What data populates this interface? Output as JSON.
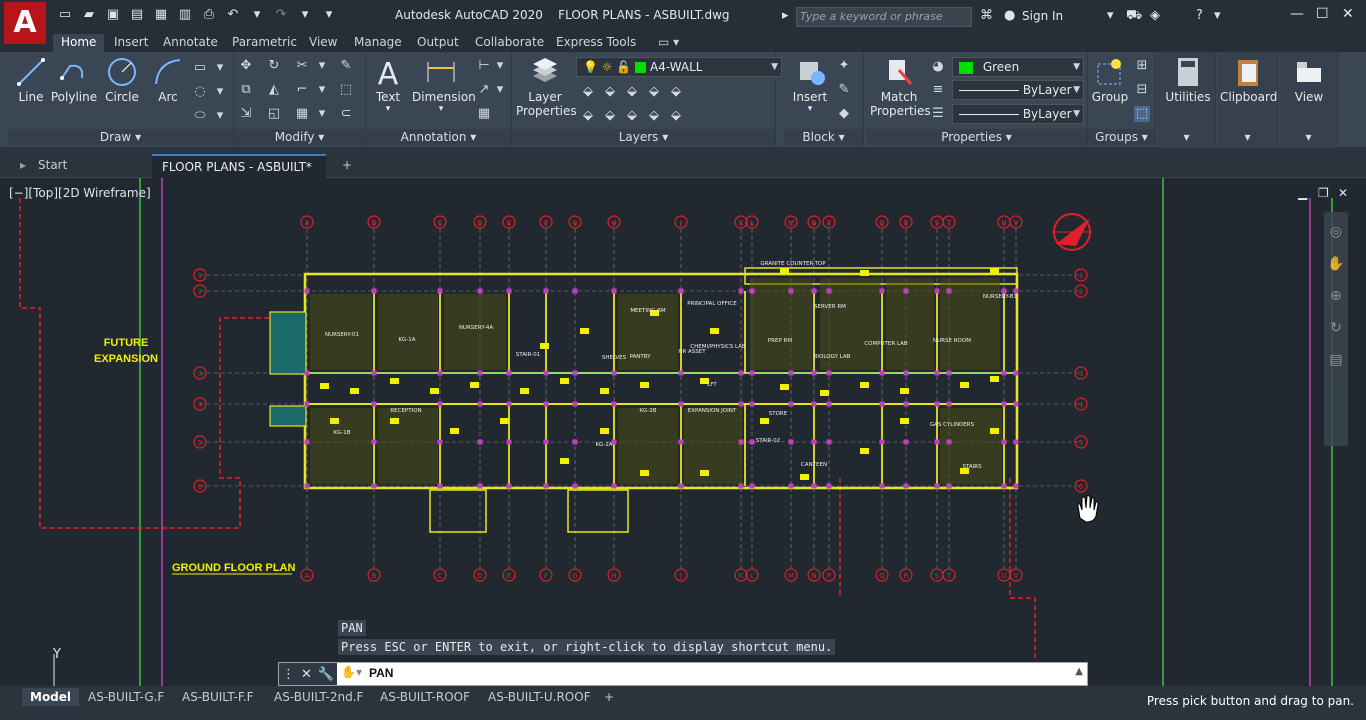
{
  "app": {
    "logo_letter": "A",
    "title": "Autodesk AutoCAD 2020    FLOOR PLANS - ASBUILT.dwg",
    "search_placeholder": "Type a keyword or phrase",
    "signin": "Sign In"
  },
  "ribbon_tabs": [
    "Home",
    "Insert",
    "Annotate",
    "Parametric",
    "View",
    "Manage",
    "Output",
    "Collaborate",
    "Express Tools"
  ],
  "ribbon": {
    "draw": {
      "title": "Draw",
      "line": "Line",
      "polyline": "Polyline",
      "circle": "Circle",
      "arc": "Arc"
    },
    "modify": {
      "title": "Modify"
    },
    "annotation": {
      "title": "Annotation",
      "text": "Text",
      "dimension": "Dimension"
    },
    "layers": {
      "title": "Layers",
      "layer_properties": "Layer\nProperties",
      "layer_properties_1": "Layer",
      "layer_properties_2": "Properties",
      "current_layer": "A4-WALL"
    },
    "block": {
      "title": "Block",
      "insert": "Insert"
    },
    "properties": {
      "title": "Properties",
      "match_1": "Match",
      "match_2": "Properties",
      "color": "Green",
      "linetype": "ByLayer",
      "lineweight": "ByLayer"
    },
    "groups": {
      "title": "Groups",
      "group": "Group"
    },
    "utilities": "Utilities",
    "clipboard": "Clipboard",
    "view": "View"
  },
  "doc_tabs": {
    "start": "Start",
    "file": "FLOOR PLANS - ASBUILT*"
  },
  "viewport": {
    "label": "[−][Top][2D Wireframe]"
  },
  "drawing": {
    "future_expansion_1": "FUTURE",
    "future_expansion_2": "EXPANSION",
    "plan_title": "GROUND FLOOR PLAN",
    "grid_top": [
      "A",
      "B",
      "C",
      "D",
      "E",
      "F",
      "G",
      "H",
      "J",
      "K",
      "L",
      "M",
      "N",
      "P",
      "Q",
      "R",
      "S",
      "T",
      "U",
      "V"
    ],
    "grid_side": [
      "1",
      "2",
      "3",
      "4",
      "5",
      "6"
    ],
    "rooms": [
      {
        "label": "NURSERY-01"
      },
      {
        "label": "KG-1A"
      },
      {
        "label": "NURSERY-4A"
      },
      {
        "label": "STAIR-01"
      },
      {
        "label": "SHELVES"
      },
      {
        "label": "PANTRY"
      },
      {
        "label": "MEETING RM"
      },
      {
        "label": "PRINCIPAL OFFICE"
      },
      {
        "label": "HR ASSET"
      },
      {
        "label": "CHEMI/PHYSICS LAB"
      },
      {
        "label": "PREP RM"
      },
      {
        "label": "SERVER RM"
      },
      {
        "label": "BIOLOGY LAB"
      },
      {
        "label": "COMPUTER LAB"
      },
      {
        "label": "NURSE ROOM"
      },
      {
        "label": "NURSERY-B1"
      },
      {
        "label": "KG-1B"
      },
      {
        "label": "RECEPTION"
      },
      {
        "label": "KG-2A"
      },
      {
        "label": "KG-2B"
      },
      {
        "label": "EXPANSION JOINT"
      },
      {
        "label": "LFT"
      },
      {
        "label": "STORE"
      },
      {
        "label": "STAIR-02"
      },
      {
        "label": "CANTEEN"
      },
      {
        "label": "STAIRS"
      },
      {
        "label": "GAS CYLINDERS"
      },
      {
        "label": "GRANITE COUNTER-TOP"
      }
    ]
  },
  "command": {
    "history_1": "PAN",
    "history_2": "Press ESC or ENTER to exit, or right-click to display shortcut menu.",
    "input": "PAN"
  },
  "layout_tabs": [
    "Model",
    "AS-BUILT-G.F",
    "AS-BUILT-F.F",
    "AS-BUILT-2nd.F",
    "AS-BUILT-ROOF",
    "AS-BUILT-U.ROOF"
  ],
  "status": "Press pick button and drag to pan.",
  "colors": {
    "accent_red": "#b8141b",
    "layer_green": "#00e000",
    "grid_red": "#e0202a",
    "wall_yellow": "#e6e620",
    "magenta": "#d040d0",
    "cyan": "#20c0e0"
  }
}
